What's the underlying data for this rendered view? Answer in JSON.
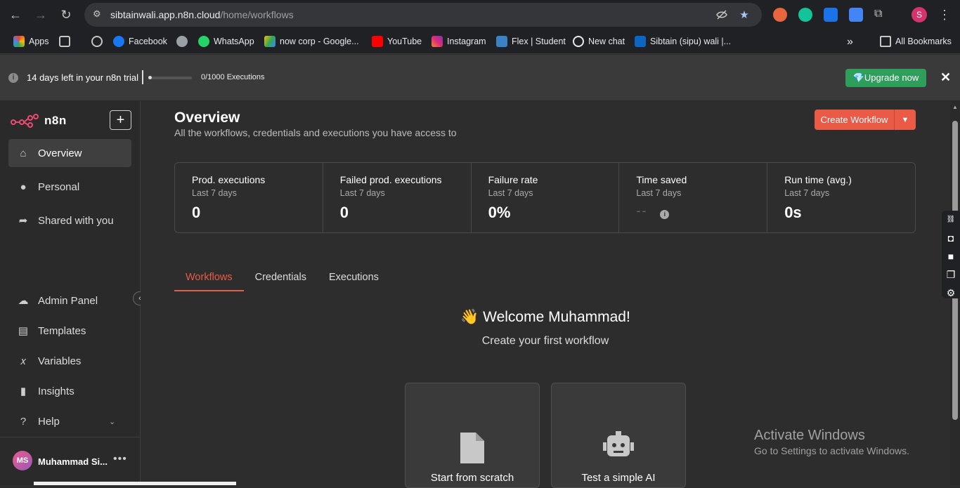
{
  "browser": {
    "url_domain": "sibtainwali.app.n8n.cloud",
    "url_path": "/home/workflows",
    "profile_initial": "S",
    "bookmarks": [
      {
        "label": "Apps",
        "icon": "apps-grid-icon"
      },
      {
        "label": "",
        "icon": "grid-icon"
      },
      {
        "label": "",
        "icon": "history-icon"
      },
      {
        "label": "Facebook",
        "icon": "facebook-icon"
      },
      {
        "label": "",
        "icon": "globe-icon"
      },
      {
        "label": "WhatsApp",
        "icon": "whatsapp-icon"
      },
      {
        "label": "now corp - Google...",
        "icon": "google-drive-icon"
      },
      {
        "label": "YouTube",
        "icon": "youtube-icon"
      },
      {
        "label": "Instagram",
        "icon": "instagram-icon"
      },
      {
        "label": "Flex | Student",
        "icon": "flex-icon"
      },
      {
        "label": "New chat",
        "icon": "chatgpt-icon"
      },
      {
        "label": "Sibtain (sipu) wali |...",
        "icon": "linkedin-icon"
      }
    ],
    "all_bookmarks": "All Bookmarks",
    "more": "»"
  },
  "trial": {
    "text": "14 days left in your n8n trial",
    "executions": "0/1000 Executions",
    "executions_used": 0,
    "upgrade_label": "💎Upgrade now",
    "close": "✕"
  },
  "sidebar": {
    "brand": "n8n",
    "add": "+",
    "items": [
      {
        "label": "Overview",
        "icon": "home-icon"
      },
      {
        "label": "Personal",
        "icon": "user-icon"
      },
      {
        "label": "Shared with you",
        "icon": "share-icon"
      }
    ],
    "bottom_items": [
      {
        "label": "Admin Panel",
        "icon": "cloud-icon"
      },
      {
        "label": "Templates",
        "icon": "box-icon"
      },
      {
        "label": "Variables",
        "icon": "variable-icon"
      },
      {
        "label": "Insights",
        "icon": "chart-icon"
      },
      {
        "label": "Help",
        "icon": "question-icon"
      }
    ],
    "user": {
      "initials": "MS",
      "name": "Muhammad Si...",
      "more": "•••"
    }
  },
  "main": {
    "title": "Overview",
    "subtitle": "All the workflows, credentials and executions you have access to",
    "create_label": "Create Workflow",
    "stats": [
      {
        "label": "Prod. executions",
        "period": "Last 7 days",
        "value": "0"
      },
      {
        "label": "Failed prod. executions",
        "period": "Last 7 days",
        "value": "0"
      },
      {
        "label": "Failure rate",
        "period": "Last 7 days",
        "value": "0%"
      },
      {
        "label": "Time saved",
        "period": "Last 7 days",
        "value": "--"
      },
      {
        "label": "Run time (avg.)",
        "period": "Last 7 days",
        "value": "0s"
      }
    ],
    "tabs": [
      "Workflows",
      "Credentials",
      "Executions"
    ],
    "welcome": "👋 Welcome Muhammad!",
    "welcome_sub": "Create your first workflow",
    "cards": [
      {
        "label": "Start from scratch",
        "icon": "file-icon"
      },
      {
        "label": "Test a simple AI",
        "icon": "robot-icon"
      }
    ]
  },
  "watermark": {
    "title": "Activate Windows",
    "subtitle": "Go to Settings to activate Windows."
  }
}
